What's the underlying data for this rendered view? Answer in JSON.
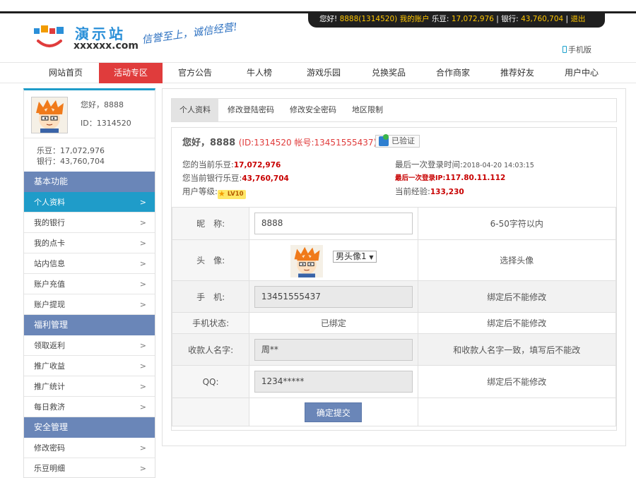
{
  "topbar": {
    "greeting": "您好!",
    "user": "8888(1314520)",
    "account_link": "我的账户",
    "ledou_label": "乐豆:",
    "ledou_value": "17,072,976",
    "bank_label": "银行:",
    "bank_value": "43,760,704",
    "sep": "|",
    "logout": "退出"
  },
  "logo": {
    "cn": "演示站",
    "en": "xxxxxx.com",
    "slogan": "信誉至上，诚信经营!"
  },
  "mobile_link": "手机版",
  "nav": [
    "网站首页",
    "活动专区",
    "官方公告",
    "牛人榜",
    "游戏乐园",
    "兑换奖品",
    "合作商家",
    "推荐好友",
    "用户中心"
  ],
  "nav_active_index": 1,
  "sidebar": {
    "hello": "您好，8888",
    "id_line": "ID：1314520",
    "ledou": "乐豆：17,072,976",
    "bank": "银行：43,760,704",
    "arrow": ">",
    "groups": [
      {
        "title": "基本功能",
        "items": [
          "个人资料",
          "我的银行",
          "我的点卡",
          "站内信息",
          "账户充值",
          "账户提现"
        ]
      },
      {
        "title": "福利管理",
        "items": [
          "领取返利",
          "推广收益",
          "推广统计",
          "每日救济"
        ]
      },
      {
        "title": "安全管理",
        "items": [
          "修改密码",
          "乐豆明细"
        ]
      }
    ],
    "active_item": "个人资料"
  },
  "tabs": [
    "个人资料",
    "修改登陆密码",
    "修改安全密码",
    "地区限制"
  ],
  "tab_active_index": 0,
  "profile": {
    "greet_name": "您好，8888",
    "greet_ids": "(ID:1314520 帐号:13451555437)",
    "verified": "已验证",
    "current_ledou_label": "您的当前乐豆:",
    "current_ledou": "17,072,976",
    "bank_ledou_label": "您当前银行乐豆:",
    "bank_ledou": "43,760,704",
    "level_label": "用户等级:",
    "level": "LV10",
    "last_login_label": "最后一次登录时间:",
    "last_login": "2018-04-20 14:03:15",
    "last_ip_label": "最后一次登录IP:",
    "last_ip": "117.80.11.112",
    "exp_label": "当前经验:",
    "exp": "133,230"
  },
  "form": {
    "nickname_label": "昵　称:",
    "nickname_value": "8888",
    "nickname_tip": "6-50字符以内",
    "avatar_label": "头　像:",
    "avatar_select": "男头像1",
    "avatar_tip": "选择头像",
    "phone_label": "手　机:",
    "phone_value": "13451555437",
    "phone_tip": "绑定后不能修改",
    "phone_status_label": "手机状态:",
    "phone_status": "已绑定",
    "phone_status_tip": "绑定后不能修改",
    "payee_label": "收款人名字:",
    "payee_value": "周**",
    "payee_tip": "和收款人名字一致，填写后不能改",
    "qq_label": "QQ:",
    "qq_value": "1234*****",
    "qq_tip": "绑定后不能修改",
    "submit": "确定提交"
  }
}
